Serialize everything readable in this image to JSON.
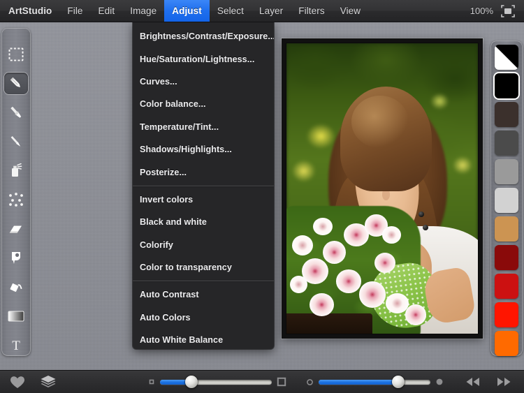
{
  "app": {
    "name": "ArtStudio",
    "zoom_level": "100%"
  },
  "menubar": {
    "items": [
      {
        "label": "ArtStudio",
        "name": "menu-artstudio",
        "active": false,
        "app": true
      },
      {
        "label": "File",
        "name": "menu-file",
        "active": false
      },
      {
        "label": "Edit",
        "name": "menu-edit",
        "active": false
      },
      {
        "label": "Image",
        "name": "menu-image",
        "active": false
      },
      {
        "label": "Adjust",
        "name": "menu-adjust",
        "active": true
      },
      {
        "label": "Select",
        "name": "menu-select",
        "active": false
      },
      {
        "label": "Layer",
        "name": "menu-layer",
        "active": false
      },
      {
        "label": "Filters",
        "name": "menu-filters",
        "active": false
      },
      {
        "label": "View",
        "name": "menu-view",
        "active": false
      }
    ],
    "right": {
      "zoom_label": "100%",
      "fit_icon": "fit-to-screen-icon"
    },
    "active_accent": "#1f6fee"
  },
  "adjust_menu": {
    "open": true,
    "groups": [
      {
        "items": [
          "Brightness/Contrast/Exposure...",
          "Hue/Saturation/Lightness...",
          "Curves...",
          "Color balance...",
          "Temperature/Tint...",
          "Shadows/Highlights...",
          "Posterize..."
        ]
      },
      {
        "items": [
          "Invert colors",
          "Black and white",
          "Colorify",
          "Color to transparency"
        ]
      },
      {
        "items": [
          "Auto Contrast",
          "Auto Colors",
          "Auto White Balance"
        ]
      }
    ],
    "background": "#262628"
  },
  "toolbar": {
    "tools": [
      {
        "name": "rectangular-marquee-icon",
        "label": "Rectangular Marquee",
        "selected": false
      },
      {
        "name": "pencil-icon",
        "label": "Pencil",
        "selected": true
      },
      {
        "name": "paintbrush-icon",
        "label": "Paintbrush",
        "selected": false
      },
      {
        "name": "brush-icon",
        "label": "Brush",
        "selected": false
      },
      {
        "name": "spray-can-icon",
        "label": "Spray Can",
        "selected": false
      },
      {
        "name": "dots-pattern-icon",
        "label": "Scatter",
        "selected": false
      },
      {
        "name": "eraser-icon",
        "label": "Eraser",
        "selected": false
      },
      {
        "name": "smudge-icon",
        "label": "Smudge",
        "selected": false
      },
      {
        "name": "paint-bucket-icon",
        "label": "Paint Bucket",
        "selected": false
      },
      {
        "name": "gradient-icon",
        "label": "Gradient",
        "selected": false
      },
      {
        "name": "text-tool-icon",
        "label": "Text",
        "selected": false
      }
    ]
  },
  "palette": {
    "swatches": [
      {
        "name": "swatch-black-white",
        "color": "bw",
        "selected": false
      },
      {
        "name": "swatch-black",
        "color": "#000000",
        "selected": true
      },
      {
        "name": "swatch-dark-brown",
        "color": "#3b302c",
        "selected": false
      },
      {
        "name": "swatch-dark-gray",
        "color": "#4b4b4b",
        "selected": false
      },
      {
        "name": "swatch-mid-gray",
        "color": "#9a9a9a",
        "selected": false
      },
      {
        "name": "swatch-light-gray",
        "color": "#d2d2d2",
        "selected": false
      },
      {
        "name": "swatch-tan",
        "color": "#cc9452",
        "selected": false
      },
      {
        "name": "swatch-dark-red",
        "color": "#8a0a0a",
        "selected": false
      },
      {
        "name": "swatch-crimson",
        "color": "#cc1111",
        "selected": false
      },
      {
        "name": "swatch-red",
        "color": "#ff1500",
        "selected": false
      },
      {
        "name": "swatch-orange",
        "color": "#ff6a00",
        "selected": false
      }
    ]
  },
  "canvas": {
    "image_alt": "Smiling young woman with braided hair holding pink and white flowers in a garden",
    "border_color": "#111111"
  },
  "bottombar": {
    "favorites_icon": "heart-icon",
    "layers_icon": "layers-icon",
    "brush_size_slider": {
      "name": "brush-size-slider",
      "min_icon": "small-square-icon",
      "max_icon": "large-square-icon",
      "value_percent": 28
    },
    "opacity_slider": {
      "name": "opacity-slider",
      "min_icon": "small-circle-icon",
      "max_icon": "large-circle-icon",
      "value_percent": 71
    },
    "undo_icon": "undo-rewind-icon",
    "redo_icon": "redo-fastforward-icon"
  }
}
